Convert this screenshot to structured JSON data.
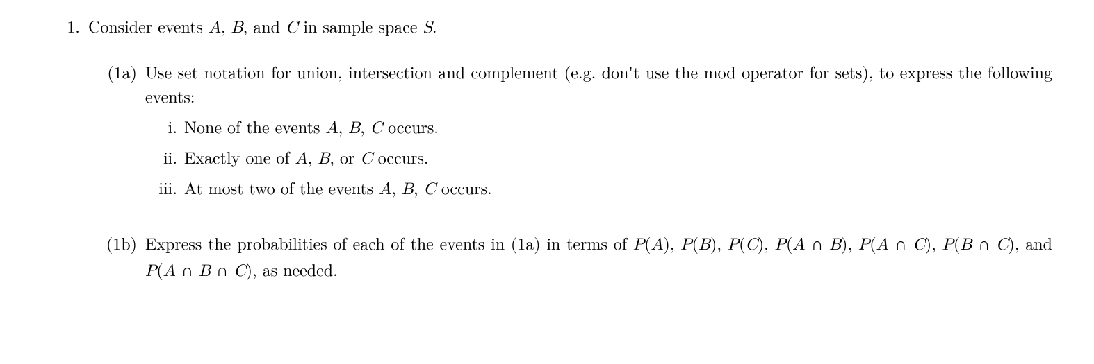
{
  "problem": {
    "number": "1.",
    "intro_pre": "Consider events ",
    "A": "A",
    "comma1": ", ",
    "B": "B",
    "comma2": ", and ",
    "C": "C",
    "intro_mid": " in sample space ",
    "S": "S",
    "intro_end": "."
  },
  "parts": {
    "a": {
      "label": "(1a)",
      "text": "Use set notation for union, intersection and complement (e.g.  don't use the mod operator for sets), to express the following events:",
      "items": [
        {
          "label": "i.",
          "pre": "None of the events ",
          "A": "A",
          "c1": ", ",
          "B": "B",
          "c2": ", ",
          "C": "C",
          "post": " occurs."
        },
        {
          "label": "ii.",
          "pre": "Exactly one of ",
          "A": "A",
          "c1": ", ",
          "B": "B",
          "c2": ", or ",
          "C": "C",
          "post": " occurs."
        },
        {
          "label": "iii.",
          "pre": "At most two of the events ",
          "A": "A",
          "c1": ", ",
          "B": "B",
          "c2": ", ",
          "C": "C",
          "post": " occurs."
        }
      ]
    },
    "b": {
      "label": "(1b)",
      "pre": "Express the probabilities of each of the events in (1a) in terms of ",
      "PA": "P",
      "PA_open": "(",
      "PA_arg": "A",
      "PA_close": ")",
      "c1": ", ",
      "PB": "P",
      "PB_open": "(",
      "PB_arg": "B",
      "PB_close": ")",
      "c2": ", ",
      "PC": "P",
      "PC_open": "(",
      "PC_arg": "C",
      "PC_close": ")",
      "c3": ", ",
      "PAB": "P",
      "PAB_open": "(",
      "PAB_A": "A",
      "cap1": " ∩ ",
      "PAB_B": "B",
      "PAB_close": ")",
      "c4": ", ",
      "PAC": "P",
      "PAC_open": "(",
      "PAC_A": "A",
      "cap2": " ∩ ",
      "PAC_C": "C",
      "PAC_close": ")",
      "c5": ", ",
      "PBC": "P",
      "PBC_open": "(",
      "PBC_B": "B",
      "cap3": " ∩ ",
      "PBC_C": "C",
      "PBC_close": ")",
      "c6": ", and ",
      "PABC": "P",
      "PABC_open": "(",
      "PABC_A": "A",
      "cap4": " ∩ ",
      "PABC_B": "B",
      "cap5": " ∩ ",
      "PABC_C": "C",
      "PABC_close": ")",
      "post": ", as needed."
    }
  }
}
